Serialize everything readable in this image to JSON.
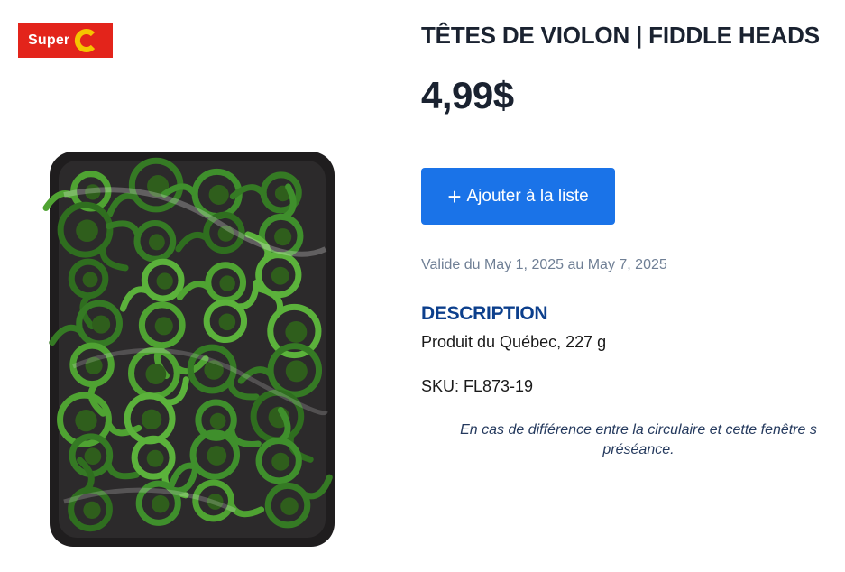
{
  "logo": {
    "text": "Super",
    "brand_color": "#e3241b",
    "accent_color": "#f5c400"
  },
  "product": {
    "title": "TÊTES DE VIOLON | FIDDLE HEADS",
    "price": "4,99$",
    "image_icon": "fiddleheads-tray-photo"
  },
  "actions": {
    "add_label": "Ajouter à la liste",
    "add_icon": "plus-icon",
    "button_color": "#1a73e8"
  },
  "validity": "Valide du May 1, 2025 au May 7, 2025",
  "description": {
    "heading": "DESCRIPTION",
    "text": "Produit du Québec, 227 g"
  },
  "sku": {
    "label": "SKU:",
    "value": "FL873-19"
  },
  "disclaimer": {
    "line1": "En cas de différence entre la circulaire et cette fenêtre s",
    "line2": "préséance."
  }
}
